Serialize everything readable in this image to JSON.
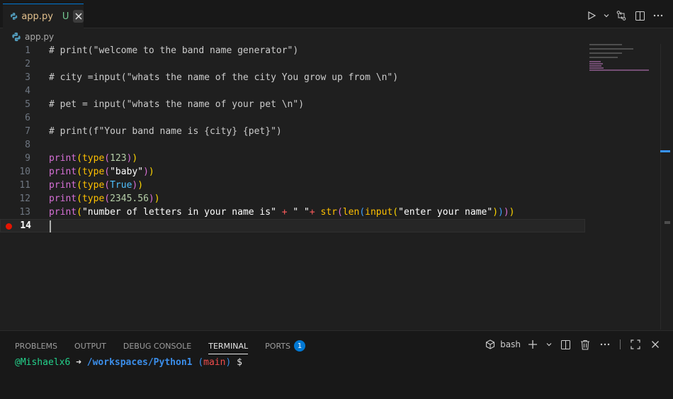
{
  "tab": {
    "filename": "app.py",
    "status": "U"
  },
  "breadcrumb": {
    "file": "app.py"
  },
  "editor": {
    "lines": [
      {
        "n": "1",
        "text": "# print(\"welcome to the band name generator\")"
      },
      {
        "n": "2",
        "text": ""
      },
      {
        "n": "3",
        "text": "# city =input(\"whats the name of the city You grow up from \\n\")"
      },
      {
        "n": "4",
        "text": ""
      },
      {
        "n": "5",
        "text": "# pet = input(\"whats the name of your pet \\n\")"
      },
      {
        "n": "6",
        "text": ""
      },
      {
        "n": "7",
        "text": "# print(f\"Your band name is {city} {pet}\")"
      },
      {
        "n": "8",
        "text": ""
      },
      {
        "n": "9",
        "text": "print(type(123))"
      },
      {
        "n": "10",
        "text": "print(type(\"baby\"))"
      },
      {
        "n": "11",
        "text": "print(type(True))"
      },
      {
        "n": "12",
        "text": "print(type(2345.56))"
      },
      {
        "n": "13",
        "text": "print(\"number of letters in your name is\" + \" \"+ str(len(input(\"enter your name\"))))"
      },
      {
        "n": "14",
        "text": ""
      }
    ],
    "active_line": 14,
    "breakpoint_line": 14
  },
  "panel": {
    "tabs": [
      {
        "label": "PROBLEMS"
      },
      {
        "label": "OUTPUT"
      },
      {
        "label": "DEBUG CONSOLE"
      },
      {
        "label": "TERMINAL"
      },
      {
        "label": "PORTS",
        "badge": "1"
      }
    ],
    "active_tab": "TERMINAL",
    "shell": "bash",
    "terminal": {
      "user": "@Mishaelx6",
      "arrow": "➜",
      "path": "/workspaces/Python1",
      "branch": "main",
      "prompt": "$"
    }
  },
  "colors": {
    "accent": "#0078d4",
    "breakpoint": "#e51400",
    "modified_filename": "#e2c08d",
    "untracked_badge": "#73c991"
  },
  "icons": {
    "tab_file": "python-icon",
    "tab_close": "close-icon",
    "run": "run-icon",
    "compare": "compare-changes-icon",
    "split": "split-editor-icon",
    "more": "more-icon",
    "terminal_shell": "terminal-icon",
    "new_terminal": "plus-icon",
    "dropdown": "chevron-down-icon",
    "split_terminal": "split-terminal-icon",
    "kill_terminal": "trash-icon",
    "maximize": "maximize-panel-icon",
    "close_panel": "close-icon"
  }
}
